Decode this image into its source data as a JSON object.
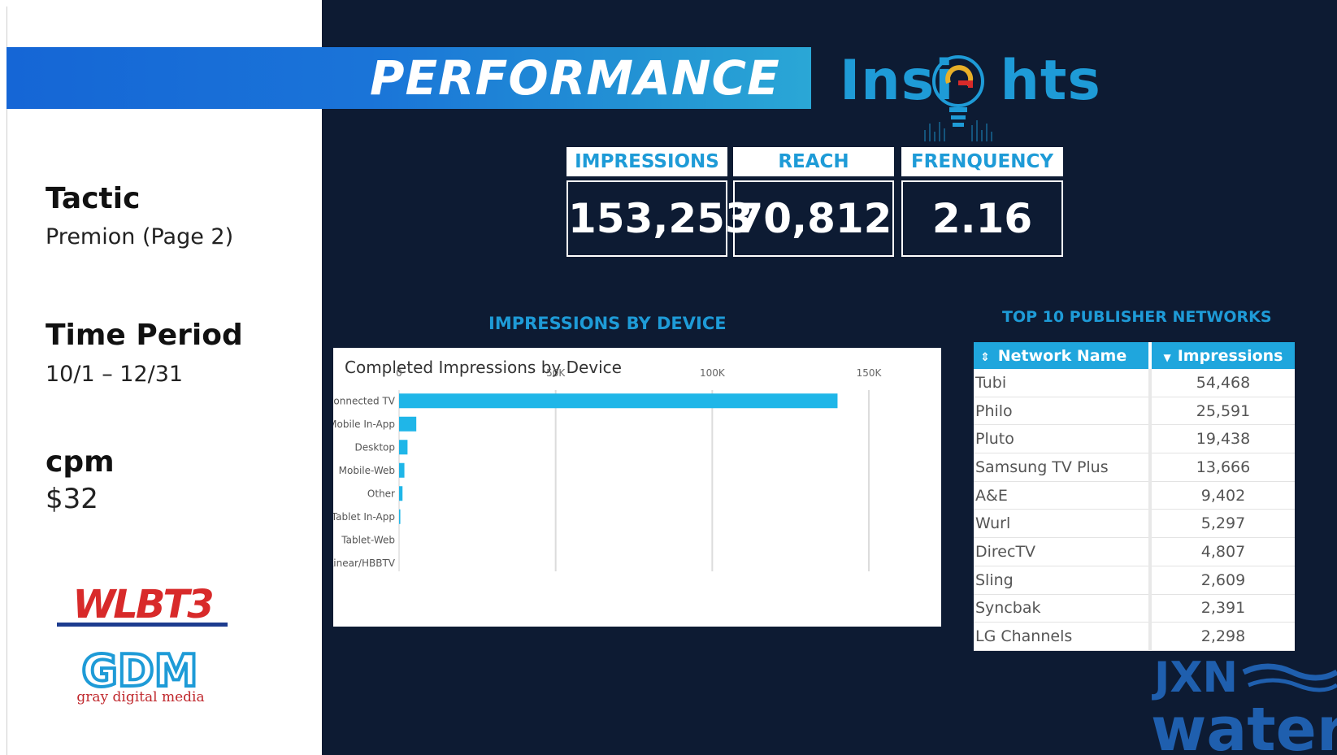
{
  "header": {
    "banner_title": "PERFORMANCE",
    "brand_title_pre": "Insi",
    "brand_title_post": "hts"
  },
  "sidebar": {
    "tactic_label": "Tactic",
    "tactic_value": "Premion (Page 2)",
    "time_label": "Time Period",
    "time_value": "10/1 – 12/31",
    "cpm_label": "cpm",
    "cpm_value": "$32",
    "logo_wlbt": "WLBT3",
    "logo_gdm": "GDM",
    "logo_gdm_sub": "gray digital media"
  },
  "kpis": [
    {
      "label": "IMPRESSIONS",
      "value": "153,253"
    },
    {
      "label": "REACH",
      "value": "70,812"
    },
    {
      "label": "FRENQUENCY",
      "value": "2.16"
    }
  ],
  "device_section_title": "IMPRESSIONS BY DEVICE",
  "chart_data": {
    "type": "bar",
    "orientation": "horizontal",
    "title": "Completed Impressions by Device",
    "categories": [
      "Connected TV",
      "Mobile In-App",
      "Desktop",
      "Mobile-Web",
      "Other",
      "Tablet In-App",
      "Tablet-Web",
      "Linear/HBBTV"
    ],
    "values": [
      140000,
      5500,
      2700,
      1700,
      1100,
      400,
      0,
      0
    ],
    "xlim": [
      0,
      150000
    ],
    "xticks": [
      0,
      50000,
      100000,
      150000
    ],
    "xtick_labels": [
      "0",
      "50K",
      "100K",
      "150K"
    ],
    "grid": true,
    "color": "#1fb6e8"
  },
  "publisher_section_title": "TOP 10 PUBLISHER NETWORKS",
  "publisher_table": {
    "columns": [
      "Network Name",
      "Impressions"
    ],
    "rows": [
      [
        "Tubi",
        "54,468"
      ],
      [
        "Philo",
        "25,591"
      ],
      [
        "Pluto",
        "19,438"
      ],
      [
        "Samsung TV Plus",
        "13,666"
      ],
      [
        "A&E",
        "9,402"
      ],
      [
        "Wurl",
        "5,297"
      ],
      [
        "DirecTV",
        "4,807"
      ],
      [
        "Sling",
        "2,609"
      ],
      [
        "Syncbak",
        "2,391"
      ],
      [
        "LG Channels",
        "2,298"
      ]
    ]
  },
  "footer_logo": {
    "line1": "JXN",
    "line2": "water"
  },
  "colors": {
    "background": "#0d1b33",
    "accent": "#1e9bd7",
    "banner_blue": "#1566d6",
    "wlbt_red": "#d82a2a"
  }
}
